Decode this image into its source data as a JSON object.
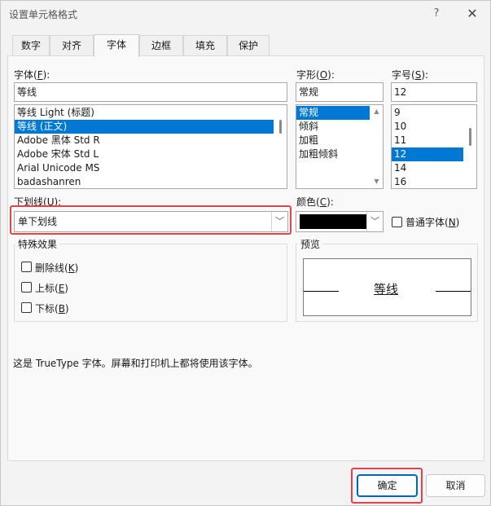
{
  "window": {
    "title": "设置单元格格式",
    "help_icon": "?",
    "close_icon": "✕"
  },
  "tabs": [
    {
      "label": "数字",
      "active": false
    },
    {
      "label": "对齐",
      "active": false
    },
    {
      "label": "字体",
      "active": true
    },
    {
      "label": "边框",
      "active": false
    },
    {
      "label": "填充",
      "active": false
    },
    {
      "label": "保护",
      "active": false
    }
  ],
  "font": {
    "label_prefix": "字体(",
    "label_key": "F",
    "label_suffix": "):",
    "value": "等线",
    "items": [
      "等线 Light (标题)",
      "等线 (正文)",
      "Adobe 黑体 Std R",
      "Adobe 宋体 Std L",
      "Arial Unicode MS",
      "badashanren"
    ],
    "selected_index": 1
  },
  "style": {
    "label_prefix": "字形(",
    "label_key": "O",
    "label_suffix": "):",
    "value": "常规",
    "items": [
      "常规",
      "倾斜",
      "加粗",
      "加粗倾斜"
    ],
    "selected_index": 0
  },
  "size": {
    "label_prefix": "字号(",
    "label_key": "S",
    "label_suffix": "):",
    "value": "12",
    "items": [
      "9",
      "10",
      "11",
      "12",
      "14",
      "16"
    ],
    "selected_index": 3
  },
  "underline": {
    "label_prefix": "下划线(",
    "label_key": "U",
    "label_suffix": "):",
    "value": "单下划线"
  },
  "color": {
    "label_prefix": "颜色(",
    "label_key": "C",
    "label_suffix": "):",
    "swatch": "#000000"
  },
  "normal_font": {
    "label_prefix": "普通字体(",
    "label_key": "N",
    "label_suffix": ")",
    "checked": false
  },
  "effects": {
    "title": "特殊效果",
    "strikethrough": {
      "prefix": "删除线(",
      "key": "K",
      "suffix": ")"
    },
    "superscript": {
      "prefix": "上标(",
      "key": "E",
      "suffix": ")"
    },
    "subscript": {
      "prefix": "下标(",
      "key": "B",
      "suffix": ")"
    }
  },
  "preview": {
    "title": "预览",
    "text": "等线"
  },
  "info_text": "这是 TrueType 字体。屏幕和打印机上都将使用该字体。",
  "buttons": {
    "ok": "确定",
    "cancel": "取消"
  },
  "colors": {
    "selection": "#0078d4",
    "highlight": "#e0454a",
    "primary_border": "#0067c0"
  }
}
